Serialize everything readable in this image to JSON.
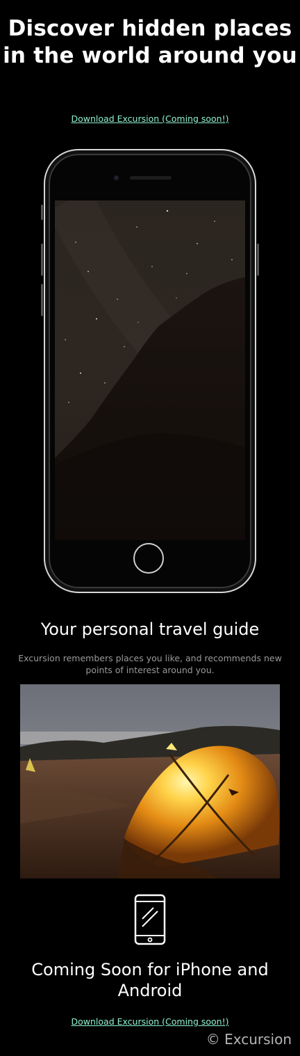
{
  "hero": {
    "title": "Discover hidden places in the world around you"
  },
  "download_link_top": {
    "label": "Download Excursion (Coming soon!)"
  },
  "guide": {
    "title": "Your personal travel guide",
    "description": "Excursion remembers places you like, and recommends new points of interest around you."
  },
  "coming_soon": {
    "title": "Coming Soon for iPhone and Android"
  },
  "download_link_bottom": {
    "label": "Download Excursion (Coming soon!)"
  },
  "footer": {
    "copyright": "© Excursion"
  },
  "colors": {
    "background": "#000000",
    "link": "#8ff0d2",
    "muted_text": "#9a9a9a"
  },
  "icons": {
    "phone_mockup": "iphone-device",
    "mobile_icon": "mobile-phone-icon"
  }
}
